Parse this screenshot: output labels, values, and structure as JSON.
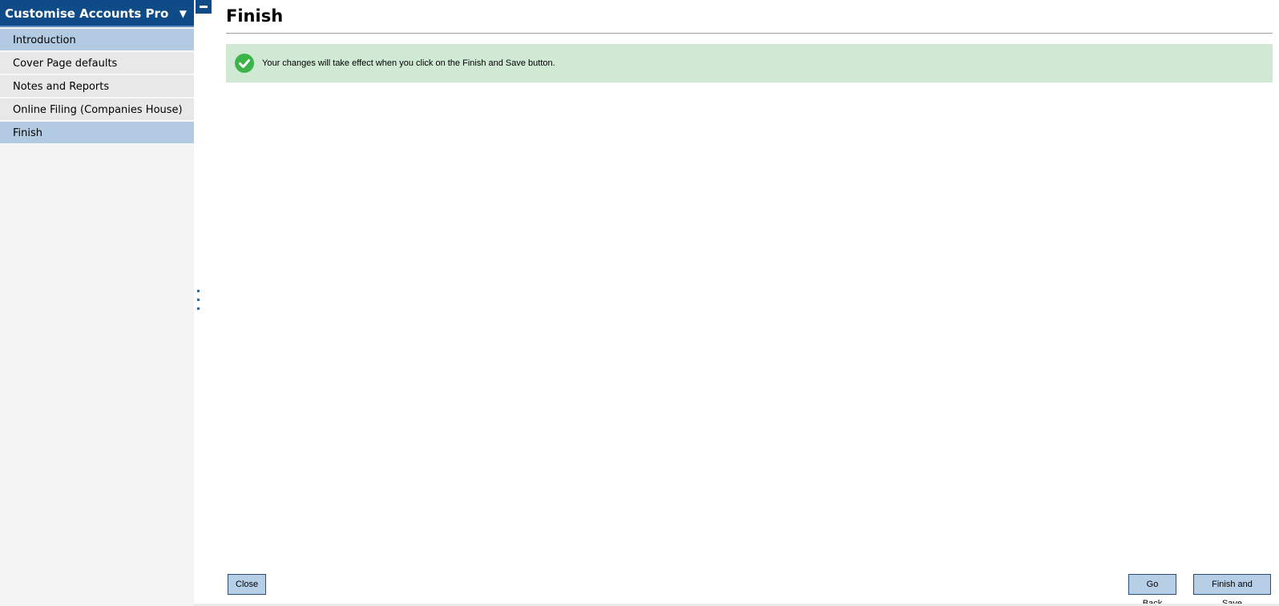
{
  "sidebar": {
    "header_title": "Customise Accounts Pro...",
    "header_caret": "▼",
    "items": [
      {
        "label": "Introduction",
        "selected": true
      },
      {
        "label": "Cover Page defaults",
        "selected": false
      },
      {
        "label": "Notes and Reports",
        "selected": false
      },
      {
        "label": "Online Filing (Companies House)",
        "selected": false
      },
      {
        "label": "Finish",
        "selected": true
      }
    ]
  },
  "main": {
    "title": "Finish",
    "banner": {
      "icon": "check-circle-icon",
      "text": "Your changes will take effect when you click on the Finish and Save button."
    }
  },
  "footer": {
    "close_label": "Close",
    "go_back_label": "Go Back",
    "finish_save_label": "Finish and Save"
  },
  "colors": {
    "header_blue": "#0e4b87",
    "selected_item": "#b2cbe3",
    "banner_green": "#d0e9d4",
    "check_green": "#3bb54a",
    "button_bg": "#b7cfe6"
  }
}
